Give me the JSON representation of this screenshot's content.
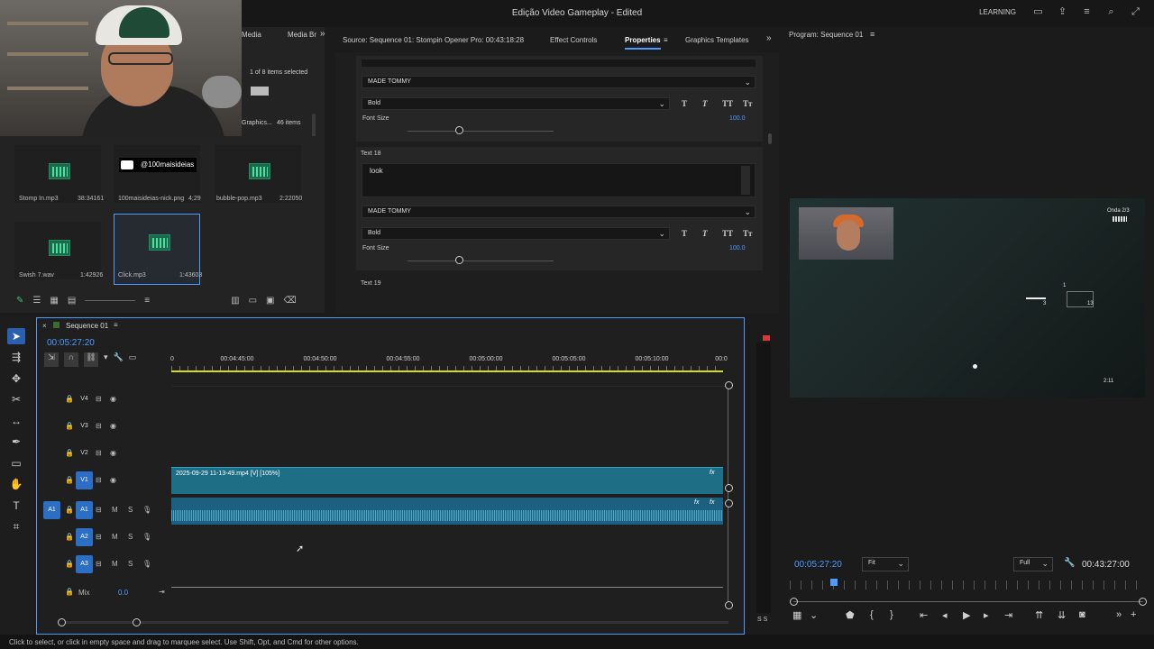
{
  "app": {
    "title": "Edição Video Gameplay - Edited",
    "learning": "LEARNING"
  },
  "project": {
    "tabs": [
      "Media",
      "Media Br"
    ],
    "selection": "1 of 8 items selected",
    "graphics_bin": "Graphics...",
    "items_count": "46 items",
    "clips": [
      {
        "name": "Stomp In.mp3",
        "duration": "38:34161"
      },
      {
        "name": "100maisideias-nick.png",
        "duration": "4;29",
        "overlay": "@100maisideias"
      },
      {
        "name": "bubble-pop.mp3",
        "duration": "2:22050"
      },
      {
        "name": "Swish 7.wav",
        "duration": "1:42926"
      },
      {
        "name": "Click.mp3",
        "duration": "1:43603"
      }
    ]
  },
  "source": {
    "tabs": [
      "Source: Sequence 01: Stompin Opener Pro: 00:43:18:28",
      "Effect Controls",
      "Properties",
      "Graphics Templates"
    ],
    "font1": "MADE TOMMY",
    "style1": "Bold",
    "fontsize_label1": "Font Size",
    "fontsize1": "100.0",
    "text18_label": "Text 18",
    "text18_value": "look",
    "font2": "MADE TOMMY",
    "style2": "Bold",
    "fontsize_label2": "Font Size",
    "fontsize2": "100.0",
    "text19_label": "Text 19",
    "format_buttons": [
      "T",
      "T",
      "TT",
      "Tт"
    ]
  },
  "program": {
    "title": "Program: Sequence 01",
    "timecode": "00:05:27:20",
    "fit": "Fit",
    "quality": "Full",
    "duration": "00:43:27:00",
    "hud": {
      "onda": "Onda 2/3",
      "n1": "1",
      "n2": "3",
      "n3": "13",
      "n4": "2:11"
    }
  },
  "timeline": {
    "sequence": "Sequence 01",
    "timecode": "00:05:27:20",
    "ruler": [
      "0",
      "00:04:45:00",
      "00:04:50:00",
      "00:04:55:00",
      "00:05:00:00",
      "00:05:05:00",
      "00:05:10:00",
      "00:0"
    ],
    "tracks": [
      {
        "name": "V4",
        "kind": "video"
      },
      {
        "name": "V3",
        "kind": "video"
      },
      {
        "name": "V2",
        "kind": "video"
      },
      {
        "name": "V1",
        "kind": "video"
      },
      {
        "name": "A1",
        "kind": "audio"
      },
      {
        "name": "A2",
        "kind": "audio"
      },
      {
        "name": "A3",
        "kind": "audio"
      }
    ],
    "source_patch": "A1",
    "mix_label": "Mix",
    "mix_value": "0.0",
    "clip_label": "2025-09-29 11-13-49.mp4 [V] [105%]",
    "track_ms": [
      "M",
      "S"
    ]
  },
  "meter": {
    "label": "S S"
  },
  "status": "Click to select, or click in empty space and drag to marquee select. Use Shift, Opt, and Cmd for other options."
}
